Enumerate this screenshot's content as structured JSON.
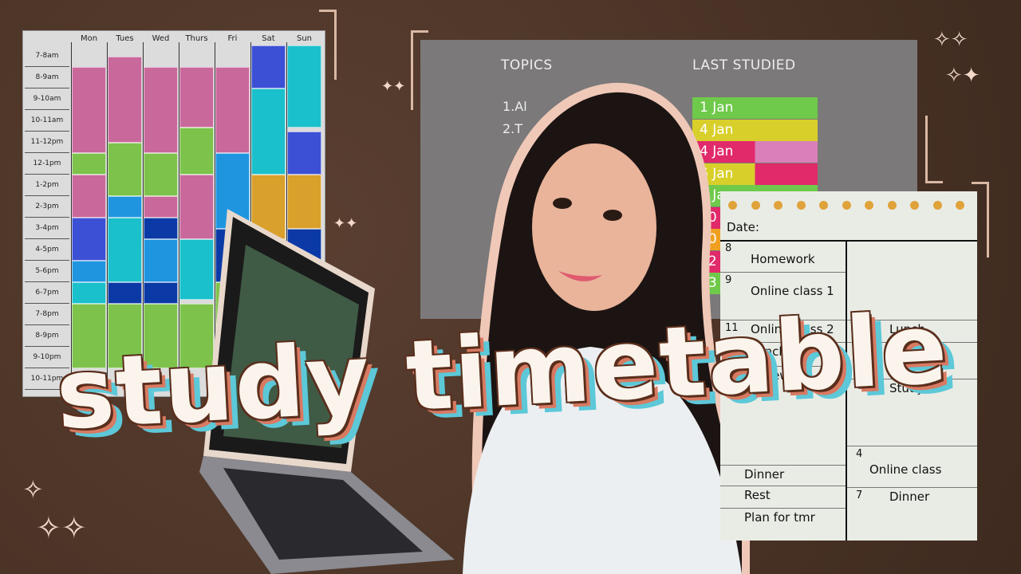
{
  "title": "study timetable",
  "timetable": {
    "days": [
      "Mon",
      "Tues",
      "Wed",
      "Thurs",
      "Fri",
      "Sat",
      "Sun"
    ],
    "rows": [
      "7-8am",
      "8-9am",
      "9-10am",
      "10-11am",
      "11-12pm",
      "12-1pm",
      "1-2pm",
      "2-3pm",
      "3-4pm",
      "4-5pm",
      "5-6pm",
      "6-7pm",
      "7-8pm",
      "8-9pm",
      "9-10pm",
      "10-11pm"
    ],
    "colors": {
      "pink": "#c9689b",
      "green": "#7dc24b",
      "indigo": "#3c50d6",
      "azure": "#1f95e0",
      "teal": "#1ac0cb",
      "navy": "#0b3aa6",
      "mustard": "#d9a02b"
    },
    "blocks": [
      [
        [
          "pink",
          8,
          12
        ],
        [
          "green",
          12,
          13
        ],
        [
          "pink",
          13,
          15
        ],
        [
          "indigo",
          15,
          17
        ],
        [
          "azure",
          17,
          18
        ],
        [
          "teal",
          18,
          19
        ],
        [
          "green",
          19,
          22
        ]
      ],
      [
        [
          "pink",
          7.5,
          11.5
        ],
        [
          "green",
          11.5,
          14
        ],
        [
          "azure",
          14,
          15
        ],
        [
          "teal",
          15,
          18
        ],
        [
          "navy",
          18,
          19
        ],
        [
          "green",
          19,
          22
        ]
      ],
      [
        [
          "pink",
          8,
          12
        ],
        [
          "green",
          12,
          14
        ],
        [
          "pink",
          14,
          15
        ],
        [
          "navy",
          15,
          16
        ],
        [
          "azure",
          16,
          18
        ],
        [
          "navy",
          18,
          19
        ],
        [
          "green",
          19,
          22
        ]
      ],
      [
        [
          "pink",
          8,
          10.8
        ],
        [
          "green",
          10.8,
          13
        ],
        [
          "pink",
          13,
          16
        ],
        [
          "teal",
          16,
          18.8
        ],
        [
          "green",
          19,
          22
        ]
      ],
      [
        [
          "pink",
          8,
          12
        ],
        [
          "azure",
          12,
          15.5
        ],
        [
          "navy",
          15.5,
          18
        ],
        [
          "green",
          18,
          22
        ]
      ],
      [
        [
          "indigo",
          7,
          9
        ],
        [
          "teal",
          9,
          13
        ],
        [
          "mustard",
          13,
          16
        ]
      ],
      [
        [
          "teal",
          7,
          10.8
        ],
        [
          "indigo",
          11,
          13
        ],
        [
          "mustard",
          13,
          15.5
        ],
        [
          "navy",
          15.5,
          17
        ]
      ]
    ]
  },
  "topics": {
    "header_topics": "TOPICS",
    "header_last": "LAST STUDIED",
    "items": [
      "1.Al",
      "2.T"
    ],
    "last_studied": [
      {
        "label": "1 Jan",
        "color": "#6fc94a"
      },
      {
        "label": "4 Jan",
        "color": "#d9cf2a"
      },
      {
        "label": "4 Jan",
        "color": "#e02a6a",
        "extra": "#d980b8"
      },
      {
        "label": "6 Jan",
        "color": "#d9cf2a",
        "extra": "#e02a6a"
      },
      {
        "label": "7 Jan",
        "color": "#6fc94a"
      },
      {
        "label": "10",
        "color": "#e02a6a"
      },
      {
        "label": "10",
        "color": "#f0a020"
      },
      {
        "label": "12",
        "color": "#e02a6a"
      },
      {
        "label": "13",
        "color": "#6fc94a"
      }
    ]
  },
  "planner": {
    "date_label": "Date:",
    "left": [
      {
        "hour": "8",
        "task": "Homework"
      },
      {
        "hour": "9",
        "task": "Online class 1"
      },
      {
        "hour": "11",
        "task": "Online class 2"
      },
      {
        "hour": "12",
        "task": "Lunch"
      },
      {
        "hour": "",
        "task": "Homework"
      },
      {
        "hour": "",
        "task": "Dinner"
      },
      {
        "hour": "",
        "task": "Rest"
      },
      {
        "hour": "",
        "task": "Plan for tmr"
      }
    ],
    "right": [
      {
        "hour": "11",
        "task": "Lunch"
      },
      {
        "hour": "12",
        "task": ""
      },
      {
        "hour": "",
        "task": "Study"
      },
      {
        "hour": "4",
        "task": "Online class"
      },
      {
        "hour": "7",
        "task": "Dinner"
      }
    ]
  }
}
